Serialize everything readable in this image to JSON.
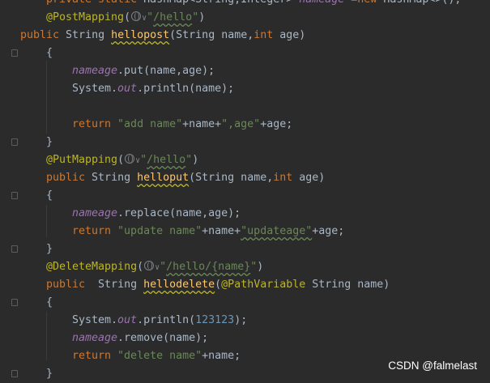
{
  "editor": {
    "lines": [
      [
        [
          "kw",
          "private static "
        ],
        [
          "plain",
          "HashMap<String,Integer> "
        ],
        [
          "fld",
          "nameage"
        ],
        [
          "plain",
          " ="
        ],
        [
          "kw",
          "new "
        ],
        [
          "plain",
          "HashMap<>();"
        ]
      ],
      [
        [
          "ann",
          "@PostMapping"
        ],
        [
          "plain",
          "("
        ],
        [
          "globe",
          ""
        ],
        [
          "str",
          "\""
        ],
        [
          "strsqg",
          "/hello"
        ],
        [
          "str",
          "\""
        ],
        [
          "plain",
          ")"
        ]
      ],
      [
        [
          "kw",
          "public "
        ],
        [
          "plain",
          "String "
        ],
        [
          "mthsq",
          "hellopost"
        ],
        [
          "plain",
          "(String name,"
        ],
        [
          "kw",
          "int "
        ],
        [
          "plain",
          "age)"
        ]
      ],
      [
        [
          "plain",
          "{"
        ]
      ],
      [
        [
          "fld",
          "nameage"
        ],
        [
          "plain",
          ".put(name,age);"
        ]
      ],
      [
        [
          "plain",
          "System."
        ],
        [
          "stat",
          "out"
        ],
        [
          "plain",
          ".println(name);"
        ]
      ],
      [
        [
          "plain",
          ""
        ]
      ],
      [
        [
          "kw",
          "return "
        ],
        [
          "str",
          "\"add name\""
        ],
        [
          "plain",
          "+name+"
        ],
        [
          "str",
          "\",age\""
        ],
        [
          "plain",
          "+age;"
        ]
      ],
      [
        [
          "plain",
          "}"
        ]
      ],
      [
        [
          "ann",
          "@PutMapping"
        ],
        [
          "plain",
          "("
        ],
        [
          "globe",
          ""
        ],
        [
          "str",
          "\""
        ],
        [
          "strsqg",
          "/hello"
        ],
        [
          "str",
          "\""
        ],
        [
          "plain",
          ")"
        ]
      ],
      [
        [
          "kw",
          "public "
        ],
        [
          "plain",
          "String "
        ],
        [
          "mthsq",
          "helloput"
        ],
        [
          "plain",
          "(String name,"
        ],
        [
          "kw",
          "int "
        ],
        [
          "plain",
          "age)"
        ]
      ],
      [
        [
          "plain",
          "{"
        ]
      ],
      [
        [
          "fld",
          "nameage"
        ],
        [
          "plain",
          ".replace(name,age);"
        ]
      ],
      [
        [
          "kw",
          "return "
        ],
        [
          "str",
          "\"update name\""
        ],
        [
          "plain",
          "+name+"
        ],
        [
          "strsqg",
          "\"updateage\""
        ],
        [
          "plain",
          "+age;"
        ]
      ],
      [
        [
          "plain",
          "}"
        ]
      ],
      [
        [
          "ann",
          "@DeleteMapping"
        ],
        [
          "plain",
          "("
        ],
        [
          "globe",
          ""
        ],
        [
          "str",
          "\""
        ],
        [
          "strsqg",
          "/hello/{name}"
        ],
        [
          "str",
          "\""
        ],
        [
          "plain",
          ")"
        ]
      ],
      [
        [
          "kw",
          "public  "
        ],
        [
          "plain",
          "String "
        ],
        [
          "mthsq",
          "hellodelete"
        ],
        [
          "plain",
          "("
        ],
        [
          "ann",
          "@PathVariable "
        ],
        [
          "plain",
          "String name)"
        ]
      ],
      [
        [
          "plain",
          "{"
        ]
      ],
      [
        [
          "plain",
          "System."
        ],
        [
          "stat",
          "out"
        ],
        [
          "plain",
          ".println("
        ],
        [
          "num",
          "123123"
        ],
        [
          "plain",
          ");"
        ]
      ],
      [
        [
          "fld",
          "nameage"
        ],
        [
          "plain",
          ".remove(name);"
        ]
      ],
      [
        [
          "kw",
          "return "
        ],
        [
          "str",
          "\"delete name\""
        ],
        [
          "plain",
          "+name;"
        ]
      ],
      [
        [
          "plain",
          "}"
        ]
      ]
    ],
    "indents": [
      2,
      2,
      1,
      2,
      4,
      4,
      4,
      4,
      2,
      2,
      2,
      2,
      4,
      4,
      2,
      2,
      2,
      2,
      4,
      4,
      4,
      2
    ]
  },
  "watermark": "CSDN @falmelast"
}
